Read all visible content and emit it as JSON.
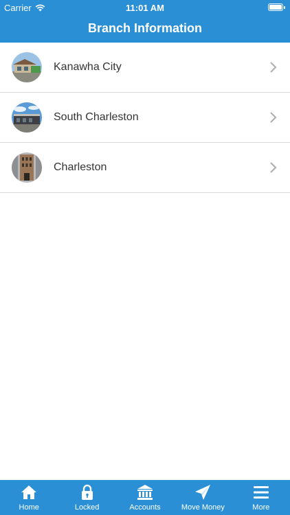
{
  "status_bar": {
    "carrier": "Carrier",
    "time": "11:01 AM"
  },
  "header": {
    "title": "Branch Information"
  },
  "branches": [
    {
      "name": "Kanawha City"
    },
    {
      "name": "South Charleston"
    },
    {
      "name": "Charleston"
    }
  ],
  "tab_bar": {
    "tabs": [
      {
        "label": "Home",
        "icon": "home-icon"
      },
      {
        "label": "Locked",
        "icon": "lock-icon"
      },
      {
        "label": "Accounts",
        "icon": "bank-icon"
      },
      {
        "label": "Move Money",
        "icon": "paper-plane-icon"
      },
      {
        "label": "More",
        "icon": "menu-icon"
      }
    ]
  },
  "colors": {
    "brand_blue": "#2a8fd4",
    "divider": "#d9d9d9",
    "text": "#333333",
    "chevron": "#b0b0b0"
  }
}
